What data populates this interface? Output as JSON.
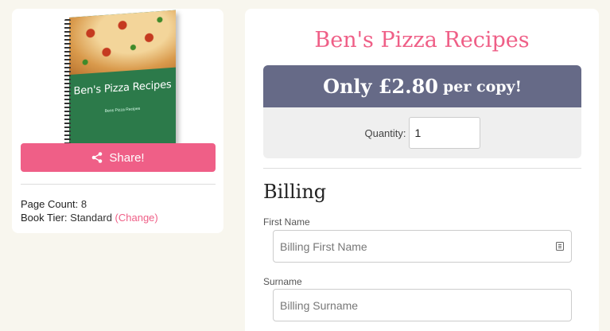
{
  "book": {
    "cover_title": "Ben's Pizza Recipes",
    "cover_author": "Bens Pizza Recipes"
  },
  "share": {
    "label": "Share!",
    "icon": "share-icon"
  },
  "meta": {
    "page_count_label": "Page Count:",
    "page_count_value": "8",
    "tier_label": "Book Tier:",
    "tier_value": "Standard",
    "change_label": "(Change)"
  },
  "product": {
    "title": "Ben's Pizza Recipes",
    "price_prefix": "Only £2.80",
    "price_suffix": "per copy!",
    "quantity_label": "Quantity:",
    "quantity_value": "1"
  },
  "billing": {
    "heading": "Billing",
    "first_name_label": "First Name",
    "first_name_placeholder": "Billing First Name",
    "surname_label": "Surname",
    "surname_placeholder": "Billing Surname"
  },
  "colors": {
    "accent": "#ef5f87",
    "price_header": "#666a87",
    "background": "#f8f6ee"
  }
}
